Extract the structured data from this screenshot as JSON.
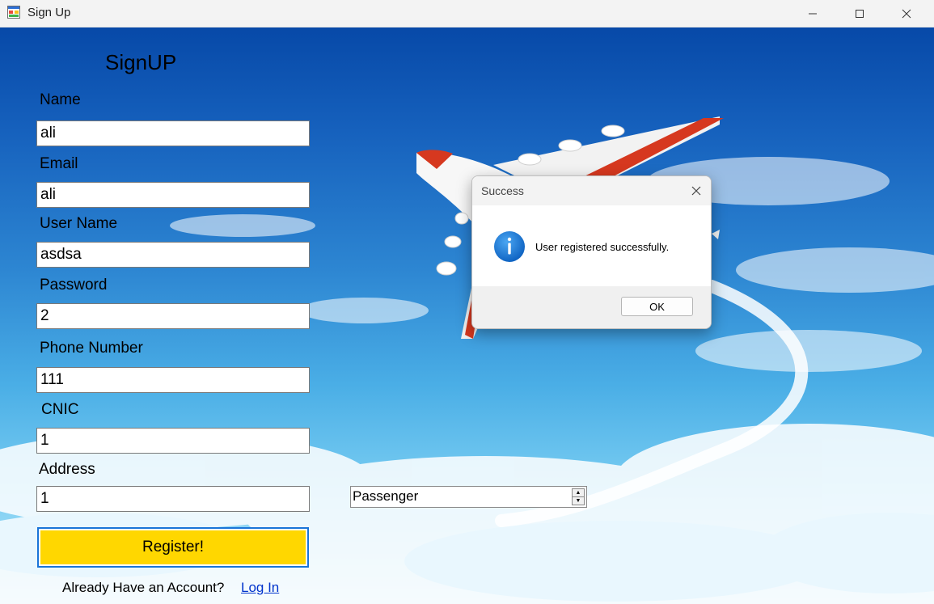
{
  "window": {
    "title": "Sign Up",
    "icon": "app-form-icon",
    "controls": [
      "minimize-icon",
      "maximize-icon",
      "close-icon"
    ]
  },
  "form": {
    "title": "SignUP",
    "fields": {
      "name": {
        "label": "Name",
        "value": "ali"
      },
      "email": {
        "label": "Email",
        "value": "ali"
      },
      "username": {
        "label": "User Name",
        "value": "asdsa"
      },
      "password": {
        "label": "Password",
        "value": "2"
      },
      "phone": {
        "label": "Phone Number",
        "value": "111"
      },
      "cnic": {
        "label": "CNIC",
        "value": "1"
      },
      "address": {
        "label": "Address",
        "value": "1"
      }
    },
    "role": {
      "value": "Passenger"
    },
    "register_label": "Register!",
    "account_prompt": "Already Have an Account?",
    "login_link": "Log In",
    "accent_color": "#ffd700"
  },
  "dialog": {
    "title": "Success",
    "message": "User registered successfully.",
    "ok_label": "OK",
    "icon": "info-icon"
  }
}
